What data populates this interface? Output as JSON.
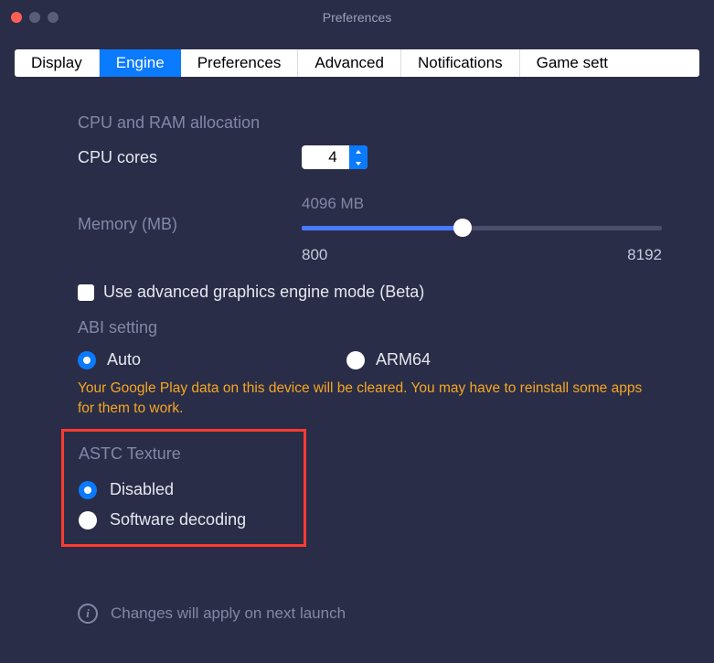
{
  "window": {
    "title": "Preferences"
  },
  "tabs": {
    "t0": "Display",
    "t1": "Engine",
    "t2": "Preferences",
    "t3": "Advanced",
    "t4": "Notifications",
    "t5": "Game sett"
  },
  "cpu_ram": {
    "section_title": "CPU and RAM allocation",
    "cores_label": "CPU cores",
    "cores_value": "4",
    "memory_label": "Memory (MB)",
    "memory_value": "4096 MB",
    "memory_min": "800",
    "memory_max": "8192",
    "memory_pct": 44.6
  },
  "advanced_gfx": {
    "label": "Use advanced graphics engine mode (Beta)",
    "checked": false
  },
  "abi": {
    "section_title": "ABI setting",
    "option_auto": "Auto",
    "option_arm64": "ARM64",
    "selected": "Auto",
    "warning": "Your Google Play data on this device will be cleared. You may have to reinstall some apps for them to work."
  },
  "astc": {
    "section_title": "ASTC Texture",
    "option_disabled": "Disabled",
    "option_software": "Software decoding",
    "selected": "Disabled"
  },
  "footer": {
    "info": "Changes will apply on next launch"
  }
}
